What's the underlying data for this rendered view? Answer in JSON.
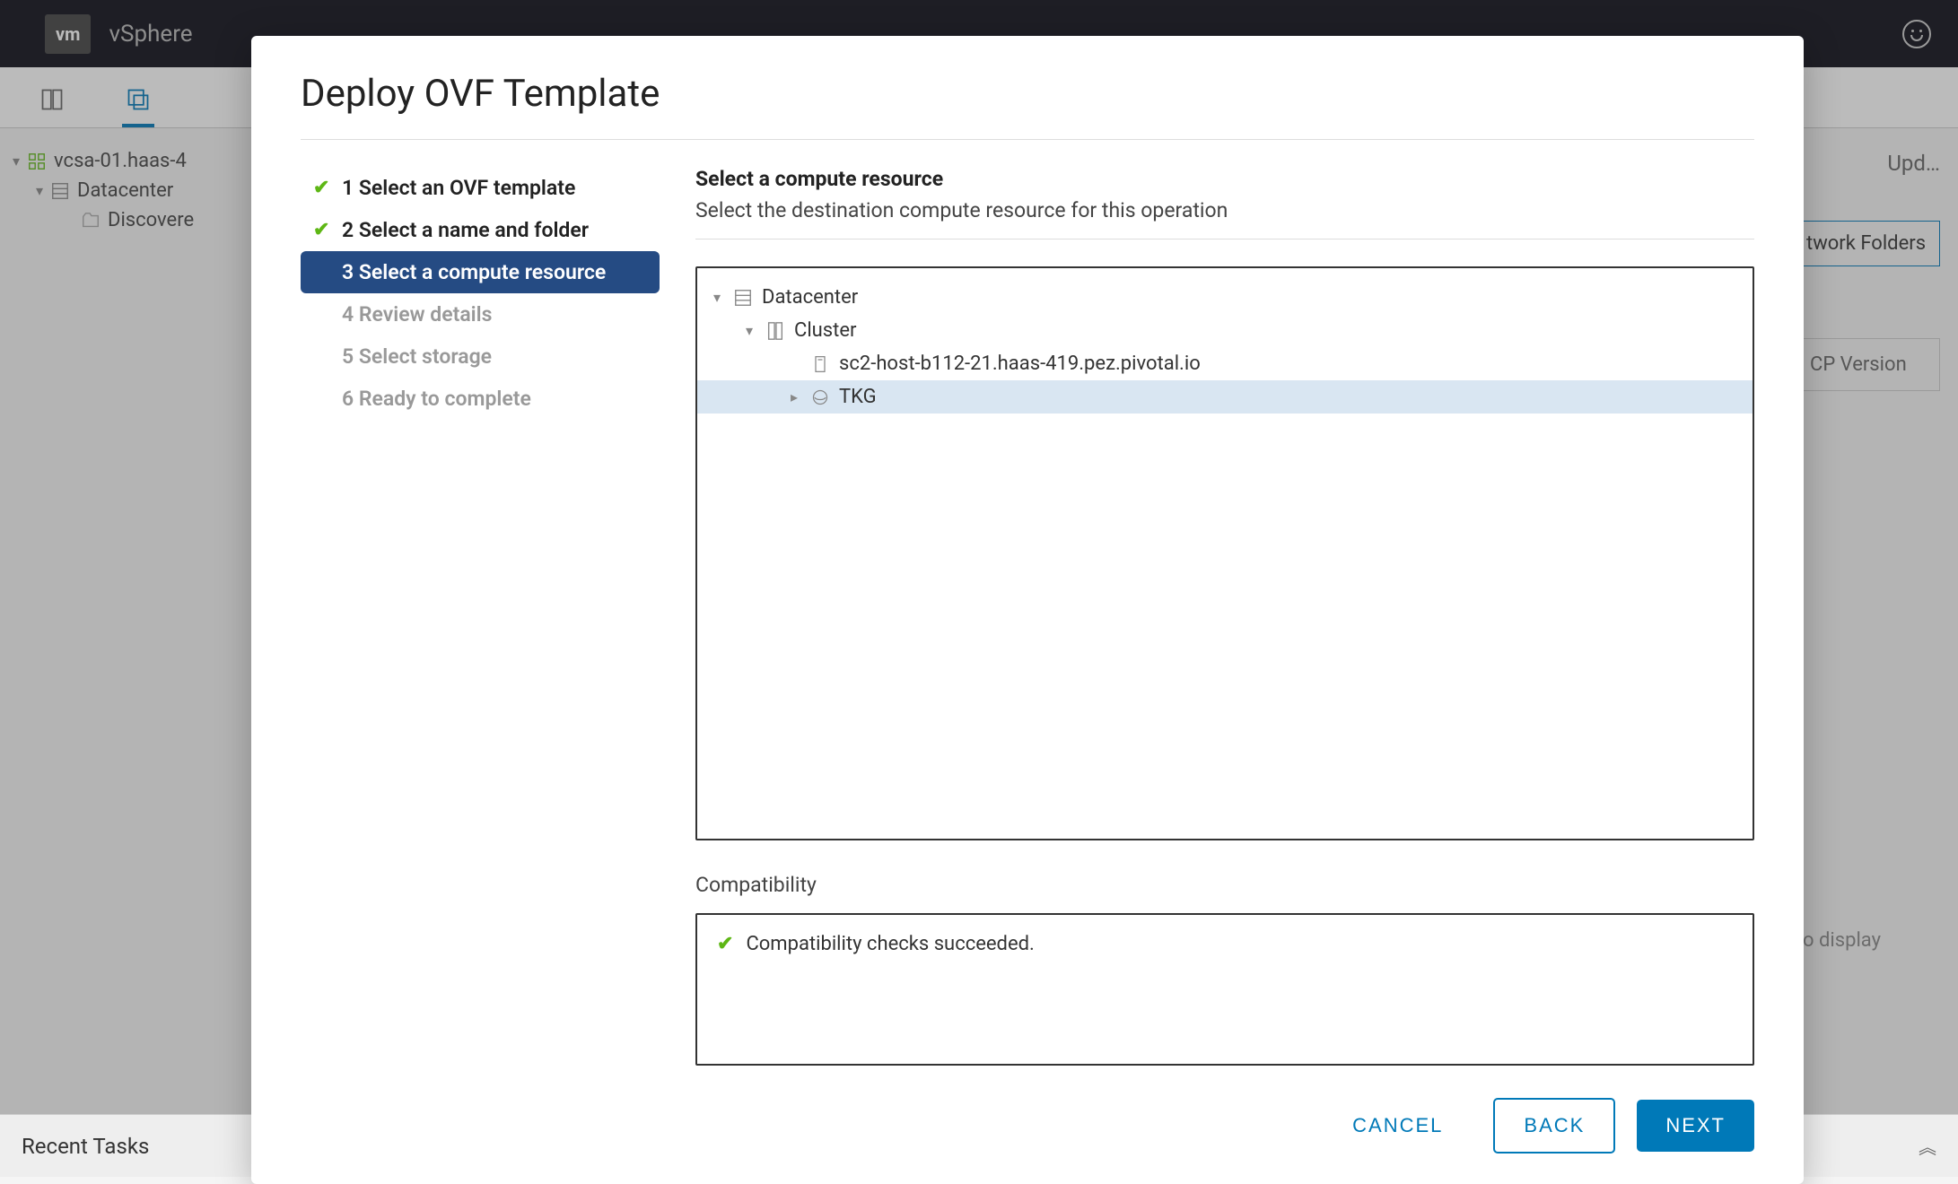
{
  "topbar": {
    "logo_text": "vm",
    "app_name": "vSphere"
  },
  "inventory": {
    "root": "vcsa-01.haas-4",
    "dc": "Datacenter",
    "discovered": "Discovere"
  },
  "background_right": {
    "updates_label": "Upd…",
    "tab_label": "twork Folders",
    "col_label": "CP Version",
    "empty_hint": "to display"
  },
  "modal": {
    "title": "Deploy OVF Template",
    "steps": [
      {
        "label": "1 Select an OVF template",
        "state": "done"
      },
      {
        "label": "2 Select a name and folder",
        "state": "done"
      },
      {
        "label": "3 Select a compute resource",
        "state": "current"
      },
      {
        "label": "4 Review details",
        "state": "future"
      },
      {
        "label": "5 Select storage",
        "state": "future"
      },
      {
        "label": "6 Ready to complete",
        "state": "future"
      }
    ],
    "panel": {
      "title": "Select a compute resource",
      "subtitle": "Select the destination compute resource for this operation"
    },
    "tree": {
      "dc": "Datacenter",
      "cluster": "Cluster",
      "host": "sc2-host-b112-21.haas-419.pez.pivotal.io",
      "pool": "TKG"
    },
    "compat": {
      "label": "Compatibility",
      "msg": "Compatibility checks succeeded."
    },
    "buttons": {
      "cancel": "CANCEL",
      "back": "BACK",
      "next": "NEXT"
    }
  },
  "recent_tasks": {
    "label": "Recent Tasks"
  }
}
